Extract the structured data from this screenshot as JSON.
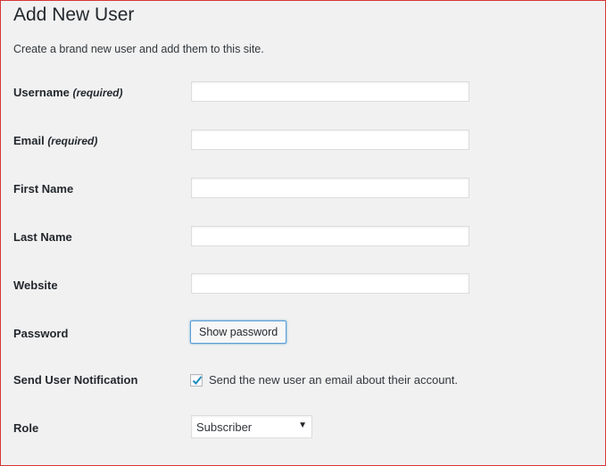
{
  "page": {
    "title": "Add New User",
    "description": "Create a brand new user and add them to this site."
  },
  "form": {
    "username": {
      "label": "Username",
      "required_note": "(required)",
      "value": ""
    },
    "email": {
      "label": "Email",
      "required_note": "(required)",
      "value": ""
    },
    "first_name": {
      "label": "First Name",
      "value": ""
    },
    "last_name": {
      "label": "Last Name",
      "value": ""
    },
    "website": {
      "label": "Website",
      "value": ""
    },
    "password": {
      "label": "Password",
      "button_label": "Show password"
    },
    "notification": {
      "label": "Send User Notification",
      "checkbox_label": "Send the new user an email about their account.",
      "checked": true
    },
    "role": {
      "label": "Role",
      "selected": "Subscriber"
    }
  },
  "colors": {
    "frame_border": "#d63638",
    "background": "#f1f1f1",
    "checkmark": "#1e8cbe",
    "button_focus": "#5b9dd9"
  },
  "icons": {
    "checkmark": "checkmark-icon",
    "select_arrow": "chevron-down-icon"
  }
}
